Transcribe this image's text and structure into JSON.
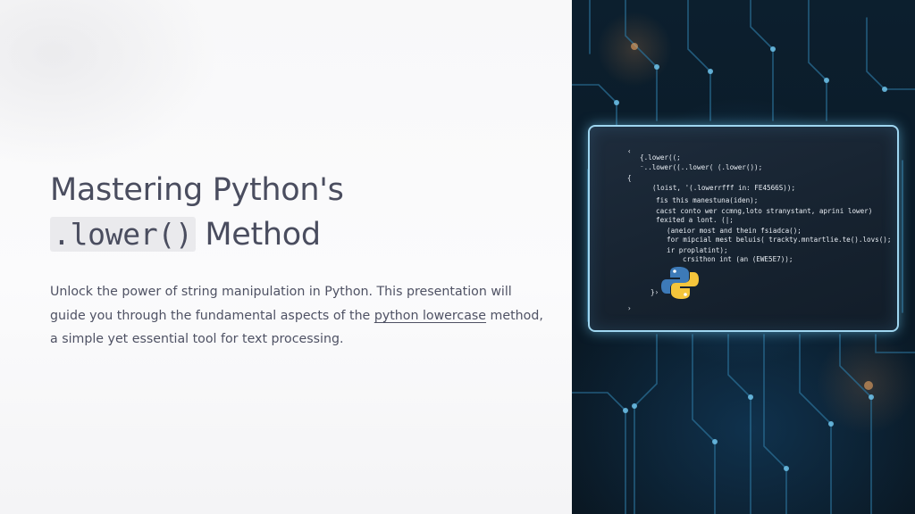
{
  "slide": {
    "title_line1": "Mastering Python's",
    "title_code": ".lower()",
    "title_line2_rest": "Method",
    "subtitle_part1": "Unlock the power of string manipulation in Python. This presentation will guide you through the fundamental aspects of the ",
    "subtitle_link": "python lowercase",
    "subtitle_part2": " method, a simple yet essential tool for text processing."
  },
  "code_screen": {
    "lines": [
      "‹",
      "{.lower((;",
      "⁻..lower((..lower( (.lower());",
      "{",
      "(loist, '(.lowerrfff in: FE4566S));",
      "fis this manestuna(iden);",
      "cacst conto wer ccmng,loto stranystant, aprini lower)",
      "fexited a lont. (|;",
      "(aneior most and thein fsiadca();",
      "for mipcial mest beluis( trackty.mntartlie.te().lovs();",
      "ir proplatint);",
      "crsithon int (an (EWE5E7));",
      "}›",
      "›"
    ]
  },
  "colors": {
    "title": "#4a4d5f",
    "body_text": "#4f5264",
    "code_bg": "#eaeaed",
    "screen_border": "#9fd6f0",
    "python_blue": "#3d7ab8",
    "python_yellow": "#f5c53b"
  },
  "icons": {
    "python_logo": "python-logo-icon"
  }
}
